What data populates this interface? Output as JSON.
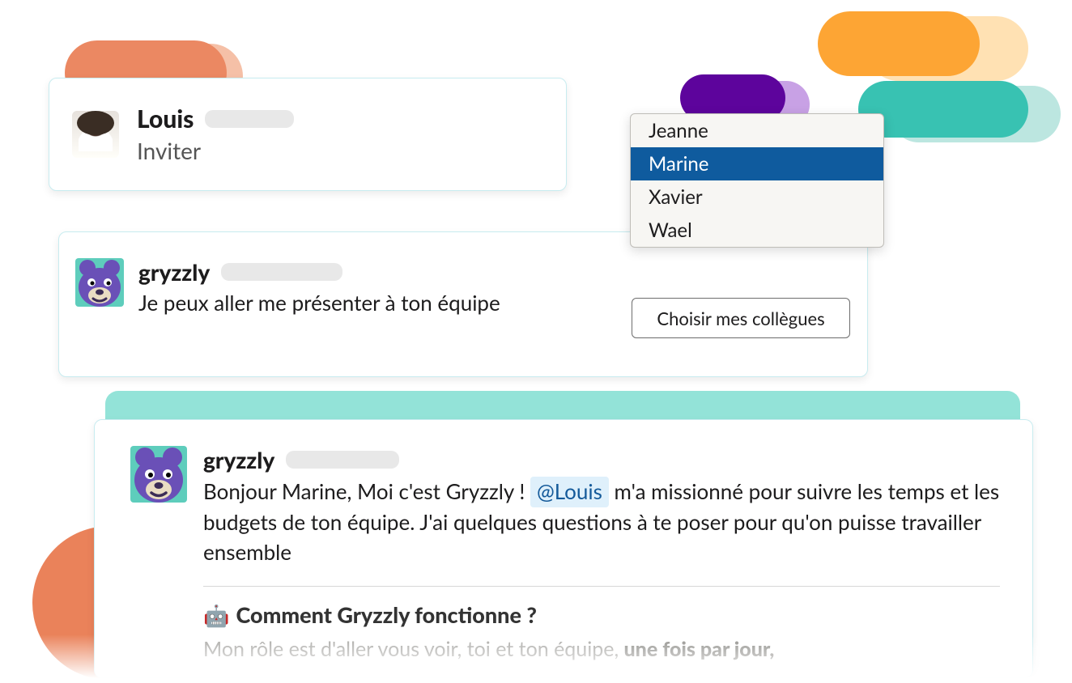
{
  "louis_card": {
    "name": "Louis",
    "sub": "Inviter"
  },
  "gryzzly1": {
    "name": "gryzzly",
    "body": "Je peux aller me présenter à ton équipe"
  },
  "dropdown": {
    "items": [
      "Jeanne",
      "Marine",
      "Xavier",
      "Wael"
    ],
    "selected_index": 1
  },
  "choose_button": "Choisir mes collègues",
  "gryzzly2": {
    "name": "gryzzly",
    "intro_before_mention": "Bonjour Marine, Moi c'est Gryzzly ! ",
    "mention": "@Louis",
    "intro_after_mention": " m'a missionné pour suivre les temps et les budgets de ton équipe. J'ai quelques questions à te poser pour qu'on puisse travailler ensemble",
    "how_title": "Comment Gryzzly fonctionne ?",
    "desc_before_strong": "Mon rôle est d'aller vous voir, toi et ton équipe, ",
    "desc_strong": "une fois par jour,"
  },
  "robot_emoji": "🤖"
}
